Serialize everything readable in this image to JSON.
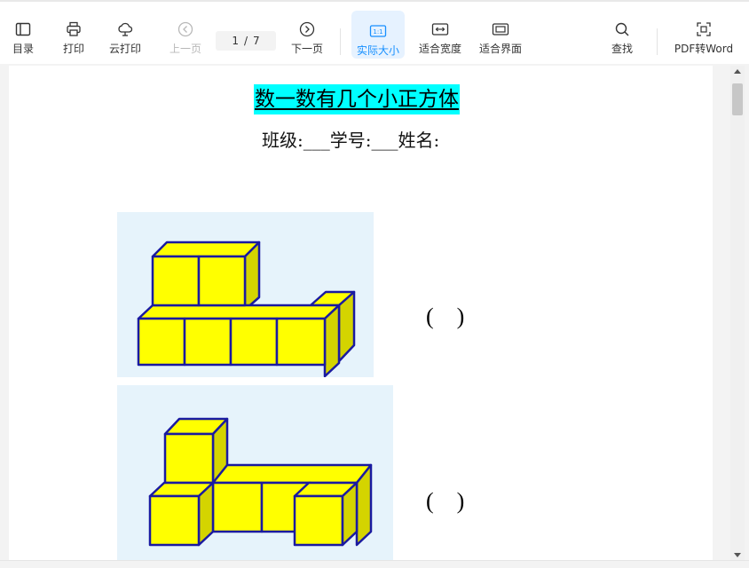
{
  "toolbar": {
    "items": [
      {
        "label": "目录",
        "icon": "toc-icon"
      },
      {
        "label": "打印",
        "icon": "printer-icon"
      },
      {
        "label": "云打印",
        "icon": "cloud-print-icon"
      },
      {
        "label": "上一页",
        "icon": "prev-page-icon"
      },
      {
        "label": "下一页",
        "icon": "next-page-icon"
      },
      {
        "label": "实际大小",
        "icon": "actual-size-icon"
      },
      {
        "label": "适合宽度",
        "icon": "fit-width-icon"
      },
      {
        "label": "适合界面",
        "icon": "fit-page-icon"
      },
      {
        "label": "查找",
        "icon": "search-icon"
      },
      {
        "label": "PDF转Word",
        "icon": "convert-icon"
      }
    ],
    "page_current": "1",
    "page_sep": "/",
    "page_total": "7",
    "actual_size_badge": "1:1"
  },
  "document": {
    "title": "数一数有几个小正方体",
    "subtitle": "班级:___学号:___姓名:",
    "answer_blank": "(    )"
  },
  "colors": {
    "accent": "#1890ff",
    "title_highlight": "#00ffff",
    "cube_fill": "#ffff00",
    "cube_stroke": "#1a1aa0",
    "figure_bg": "#e6f3fb"
  }
}
